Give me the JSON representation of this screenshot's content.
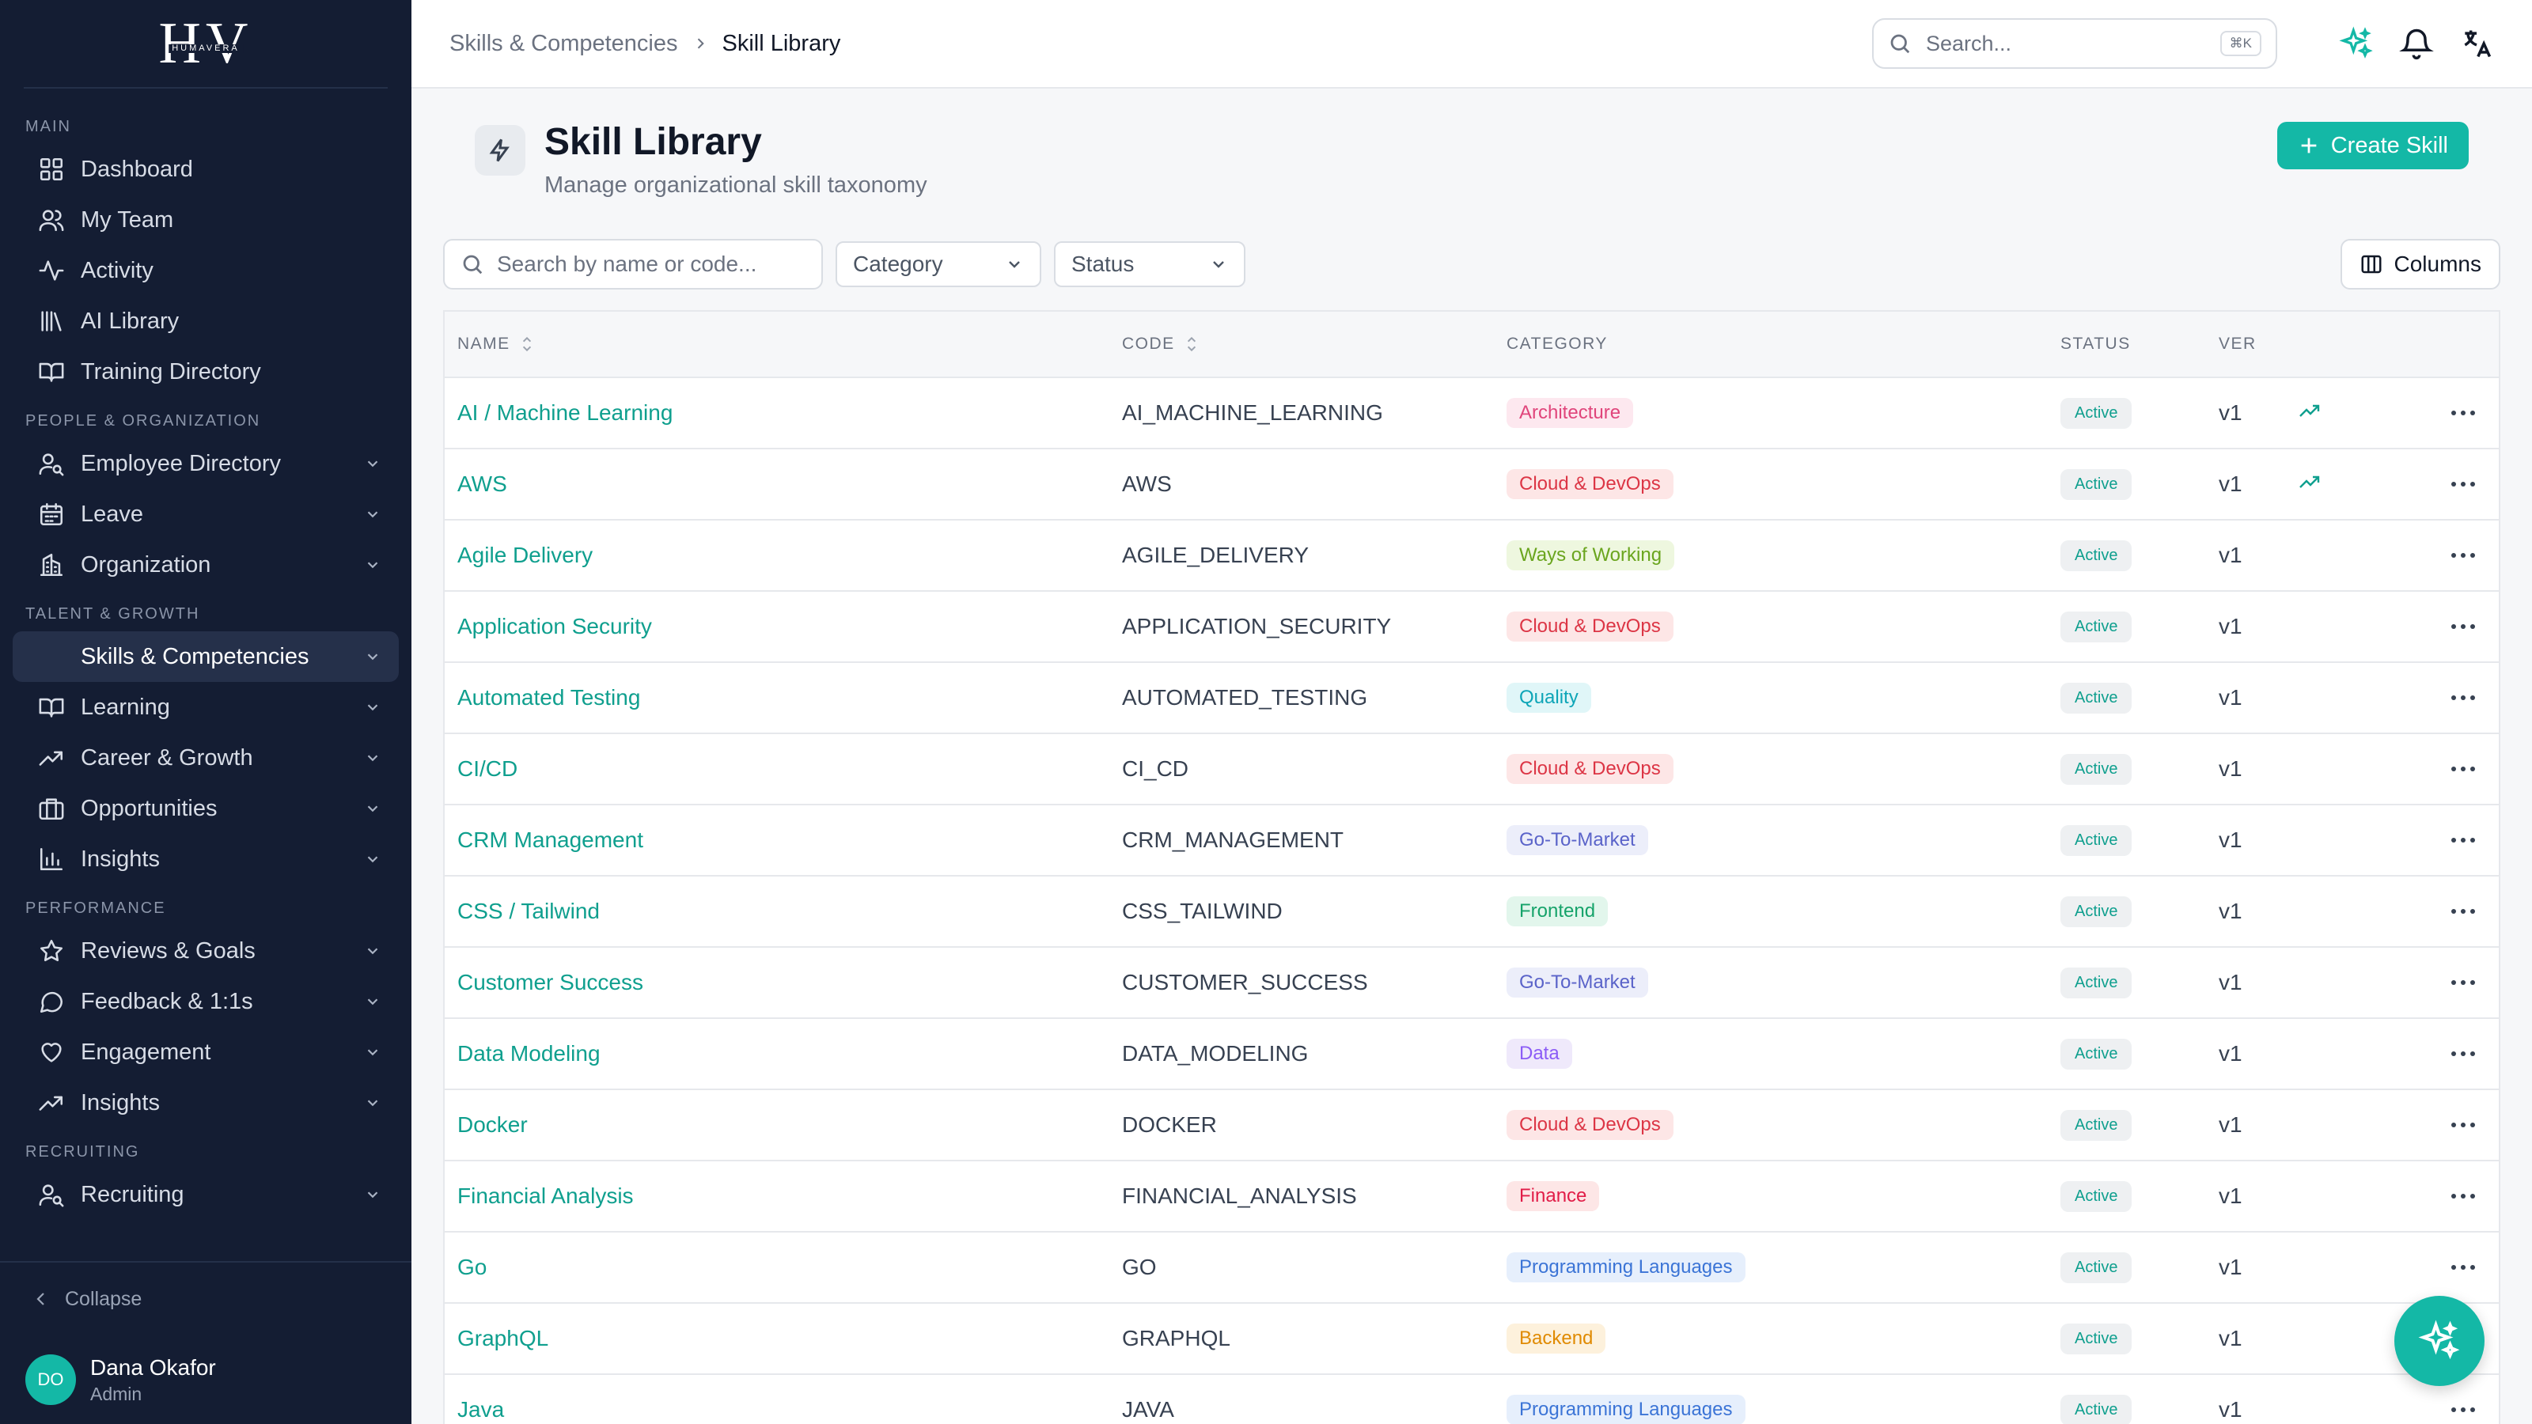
{
  "logo": {
    "mark": "HV",
    "sub": "HUMAVERA"
  },
  "sidebar": {
    "sections": [
      {
        "label": "MAIN",
        "items": [
          {
            "label": "Dashboard",
            "icon": "grid-icon",
            "chevron": false
          },
          {
            "label": "My Team",
            "icon": "users-icon",
            "chevron": false
          },
          {
            "label": "Activity",
            "icon": "activity-icon",
            "chevron": false
          },
          {
            "label": "AI Library",
            "icon": "library-icon",
            "chevron": false
          },
          {
            "label": "Training Directory",
            "icon": "book-icon",
            "chevron": false
          }
        ]
      },
      {
        "label": "PEOPLE & ORGANIZATION",
        "items": [
          {
            "label": "Employee Directory",
            "icon": "user-search-icon",
            "chevron": true
          },
          {
            "label": "Leave",
            "icon": "calendar-icon",
            "chevron": true
          },
          {
            "label": "Organization",
            "icon": "building-icon",
            "chevron": true
          }
        ]
      },
      {
        "label": "TALENT & GROWTH",
        "items": [
          {
            "label": "Skills & Competencies",
            "icon": "",
            "chevron": true,
            "active": true
          },
          {
            "label": "Learning",
            "icon": "book-icon",
            "chevron": true
          },
          {
            "label": "Career & Growth",
            "icon": "trending-icon",
            "chevron": true
          },
          {
            "label": "Opportunities",
            "icon": "briefcase-icon",
            "chevron": true
          },
          {
            "label": "Insights",
            "icon": "bar-chart-icon",
            "chevron": true
          }
        ]
      },
      {
        "label": "PERFORMANCE",
        "items": [
          {
            "label": "Reviews & Goals",
            "icon": "star-icon",
            "chevron": true
          },
          {
            "label": "Feedback & 1:1s",
            "icon": "message-icon",
            "chevron": true
          },
          {
            "label": "Engagement",
            "icon": "heart-icon",
            "chevron": true
          },
          {
            "label": "Insights",
            "icon": "trending-icon",
            "chevron": true
          }
        ]
      },
      {
        "label": "RECRUITING",
        "items": [
          {
            "label": "Recruiting",
            "icon": "user-search-icon",
            "chevron": true
          }
        ]
      }
    ],
    "collapse_label": "Collapse",
    "user": {
      "initials": "DO",
      "name": "Dana Okafor",
      "role": "Admin"
    }
  },
  "topbar": {
    "breadcrumb": [
      "Skills & Competencies",
      "Skill Library"
    ],
    "search_placeholder": "Search...",
    "search_shortcut": "⌘K"
  },
  "page": {
    "title": "Skill Library",
    "subtitle": "Manage organizational skill taxonomy",
    "create_label": "Create Skill"
  },
  "filters": {
    "search_placeholder": "Search by name or code...",
    "category_label": "Category",
    "status_label": "Status",
    "columns_label": "Columns"
  },
  "table": {
    "headers": {
      "name": "NAME",
      "code": "CODE",
      "category": "CATEGORY",
      "status": "STATUS",
      "ver": "VER"
    },
    "category_colors": {
      "Architecture": {
        "bg": "#fde8ef",
        "fg": "#e0457b"
      },
      "Cloud & DevOps": {
        "bg": "#fde6e6",
        "fg": "#dc3545"
      },
      "Ways of Working": {
        "bg": "#eef7df",
        "fg": "#6aa51e"
      },
      "Quality": {
        "bg": "#e0f6f8",
        "fg": "#0ea5b7"
      },
      "Go-To-Market": {
        "bg": "#eceefa",
        "fg": "#5a63c9"
      },
      "Frontend": {
        "bg": "#e2f6ec",
        "fg": "#16a36a"
      },
      "Data": {
        "bg": "#efe9fb",
        "fg": "#8b5cf6"
      },
      "Finance": {
        "bg": "#fde6e6",
        "fg": "#e11d48"
      },
      "Programming Languages": {
        "bg": "#e6effc",
        "fg": "#3b74d6"
      },
      "Backend": {
        "bg": "#fdf1dc",
        "fg": "#e08a00"
      }
    },
    "rows": [
      {
        "name": "AI / Machine Learning",
        "code": "AI_MACHINE_LEARNING",
        "category": "Architecture",
        "status": "Active",
        "ver": "v1",
        "trend": true
      },
      {
        "name": "AWS",
        "code": "AWS",
        "category": "Cloud & DevOps",
        "status": "Active",
        "ver": "v1",
        "trend": true
      },
      {
        "name": "Agile Delivery",
        "code": "AGILE_DELIVERY",
        "category": "Ways of Working",
        "status": "Active",
        "ver": "v1",
        "trend": false
      },
      {
        "name": "Application Security",
        "code": "APPLICATION_SECURITY",
        "category": "Cloud & DevOps",
        "status": "Active",
        "ver": "v1",
        "trend": false
      },
      {
        "name": "Automated Testing",
        "code": "AUTOMATED_TESTING",
        "category": "Quality",
        "status": "Active",
        "ver": "v1",
        "trend": false
      },
      {
        "name": "CI/CD",
        "code": "CI_CD",
        "category": "Cloud & DevOps",
        "status": "Active",
        "ver": "v1",
        "trend": false
      },
      {
        "name": "CRM Management",
        "code": "CRM_MANAGEMENT",
        "category": "Go-To-Market",
        "status": "Active",
        "ver": "v1",
        "trend": false
      },
      {
        "name": "CSS / Tailwind",
        "code": "CSS_TAILWIND",
        "category": "Frontend",
        "status": "Active",
        "ver": "v1",
        "trend": false
      },
      {
        "name": "Customer Success",
        "code": "CUSTOMER_SUCCESS",
        "category": "Go-To-Market",
        "status": "Active",
        "ver": "v1",
        "trend": false
      },
      {
        "name": "Data Modeling",
        "code": "DATA_MODELING",
        "category": "Data",
        "status": "Active",
        "ver": "v1",
        "trend": false
      },
      {
        "name": "Docker",
        "code": "DOCKER",
        "category": "Cloud & DevOps",
        "status": "Active",
        "ver": "v1",
        "trend": false
      },
      {
        "name": "Financial Analysis",
        "code": "FINANCIAL_ANALYSIS",
        "category": "Finance",
        "status": "Active",
        "ver": "v1",
        "trend": false
      },
      {
        "name": "Go",
        "code": "GO",
        "category": "Programming Languages",
        "status": "Active",
        "ver": "v1",
        "trend": false
      },
      {
        "name": "GraphQL",
        "code": "GRAPHQL",
        "category": "Backend",
        "status": "Active",
        "ver": "v1",
        "trend": false
      },
      {
        "name": "Java",
        "code": "JAVA",
        "category": "Programming Languages",
        "status": "Active",
        "ver": "v1",
        "trend": false
      }
    ]
  }
}
